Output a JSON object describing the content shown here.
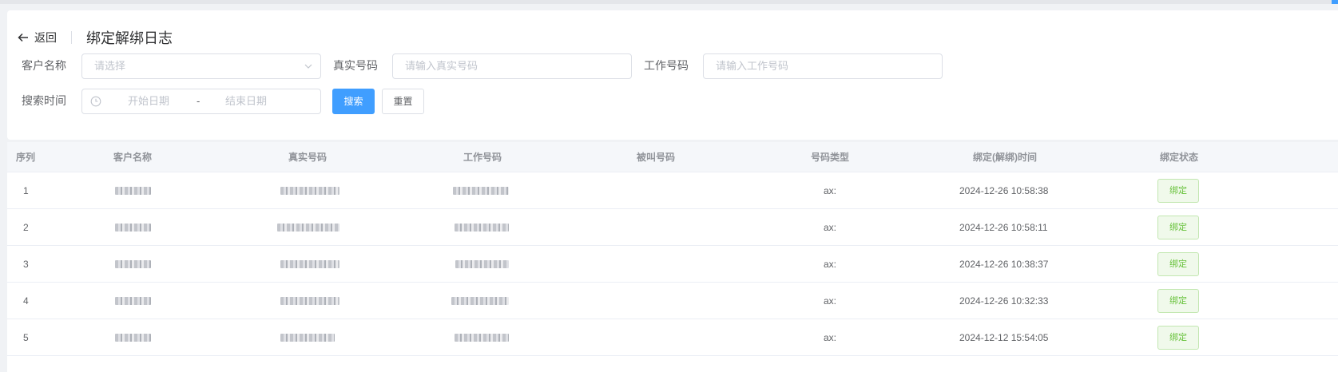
{
  "header": {
    "back_label": "返回",
    "title": "绑定解绑日志"
  },
  "filters": {
    "customer_label": "客户名称",
    "customer_placeholder": "请选择",
    "real_number_label": "真实号码",
    "real_number_placeholder": "请输入真实号码",
    "work_number_label": "工作号码",
    "work_number_placeholder": "请输入工作号码",
    "time_label": "搜索时间",
    "start_placeholder": "开始日期",
    "separator": "-",
    "end_placeholder": "结束日期",
    "search_label": "搜索",
    "reset_label": "重置"
  },
  "table": {
    "columns": [
      "序列",
      "客户名称",
      "真实号码",
      "工作号码",
      "被叫号码",
      "号码类型",
      "绑定(解绑)时间",
      "绑定状态"
    ],
    "rows": [
      {
        "index": "1",
        "number_type": "ax:",
        "time": "2024-12-26 10:58:38",
        "status": "绑定"
      },
      {
        "index": "2",
        "number_type": "ax:",
        "time": "2024-12-26 10:58:11",
        "status": "绑定"
      },
      {
        "index": "3",
        "number_type": "ax:",
        "time": "2024-12-26 10:38:37",
        "status": "绑定"
      },
      {
        "index": "4",
        "number_type": "ax:",
        "time": "2024-12-26 10:32:33",
        "status": "绑定"
      },
      {
        "index": "5",
        "number_type": "ax:",
        "time": "2024-12-12 15:54:05",
        "status": "绑定"
      }
    ]
  },
  "colors": {
    "primary": "#409eff",
    "success": "#67c23a",
    "success_bg": "#f0f9eb"
  },
  "icons": [
    "arrow-left-icon",
    "chevron-down-icon",
    "clock-icon"
  ]
}
